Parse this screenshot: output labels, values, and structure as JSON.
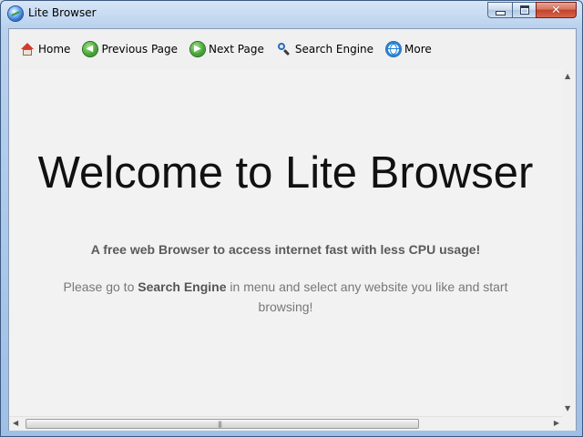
{
  "window": {
    "title": "Lite Browser",
    "controls": {
      "minimize": "minimize",
      "maximize": "maximize",
      "close": "✕"
    }
  },
  "menu": {
    "items": [
      {
        "label": "Home",
        "icon": "home-icon"
      },
      {
        "label": "Previous Page",
        "icon": "arrow-left-circle-icon"
      },
      {
        "label": "Next Page",
        "icon": "arrow-right-circle-icon"
      },
      {
        "label": "Search Engine",
        "icon": "search-icon"
      },
      {
        "label": "More",
        "icon": "globe-icon"
      }
    ]
  },
  "content": {
    "headline": "Welcome to Lite Browser",
    "tagline": "A free web Browser to access internet fast with less CPU usage!",
    "instruction_prefix": "Please go to ",
    "instruction_highlight": "Search Engine",
    "instruction_suffix": " in menu and select any website you like and start browsing!"
  },
  "colors": {
    "headline": "#111111",
    "tagline": "#5a5a5a",
    "instruction": "#777777",
    "background": "#f2f2f2"
  }
}
